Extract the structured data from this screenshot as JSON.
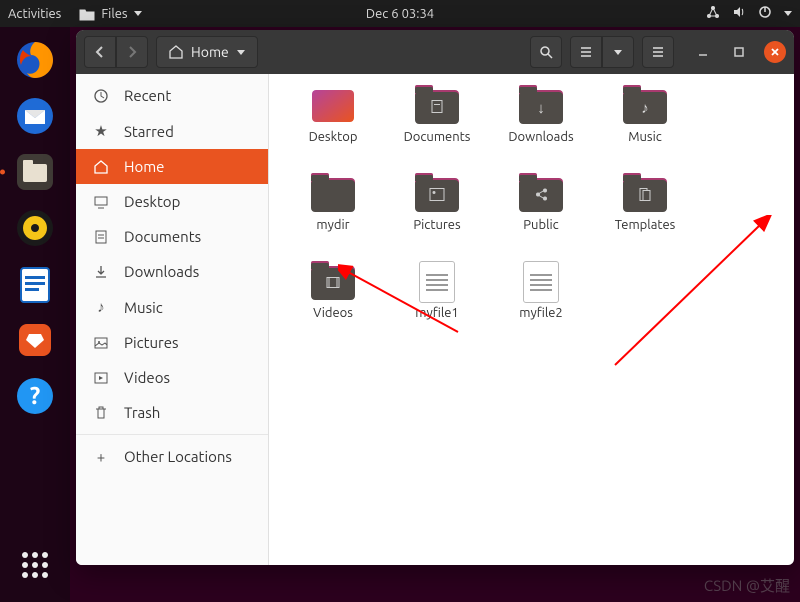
{
  "top_panel": {
    "activities": "Activities",
    "app_menu": "Files",
    "datetime": "Dec 6  03:34"
  },
  "titlebar": {
    "location": "Home"
  },
  "sidebar": {
    "items": [
      {
        "icon": "clock",
        "label": "Recent"
      },
      {
        "icon": "star",
        "label": "Starred"
      },
      {
        "icon": "home",
        "label": "Home"
      },
      {
        "icon": "desktop",
        "label": "Desktop"
      },
      {
        "icon": "doc",
        "label": "Documents"
      },
      {
        "icon": "download",
        "label": "Downloads"
      },
      {
        "icon": "music",
        "label": "Music"
      },
      {
        "icon": "pictures",
        "label": "Pictures"
      },
      {
        "icon": "videos",
        "label": "Videos"
      },
      {
        "icon": "trash",
        "label": "Trash"
      }
    ],
    "other_locations": "Other Locations"
  },
  "files": [
    {
      "type": "desktop",
      "label": "Desktop"
    },
    {
      "type": "folder",
      "icon": "doc",
      "label": "Documents"
    },
    {
      "type": "folder",
      "icon": "download",
      "label": "Downloads"
    },
    {
      "type": "folder",
      "icon": "music",
      "label": "Music"
    },
    {
      "type": "folder",
      "icon": "plain",
      "label": "mydir"
    },
    {
      "type": "folder",
      "icon": "pictures",
      "label": "Pictures"
    },
    {
      "type": "folder",
      "icon": "share",
      "label": "Public"
    },
    {
      "type": "folder",
      "icon": "templates",
      "label": "Templates"
    },
    {
      "type": "folder",
      "icon": "videos",
      "label": "Videos"
    },
    {
      "type": "file",
      "label": "myfile1"
    },
    {
      "type": "file",
      "label": "myfile2"
    }
  ],
  "watermark": "CSDN @艾醒"
}
